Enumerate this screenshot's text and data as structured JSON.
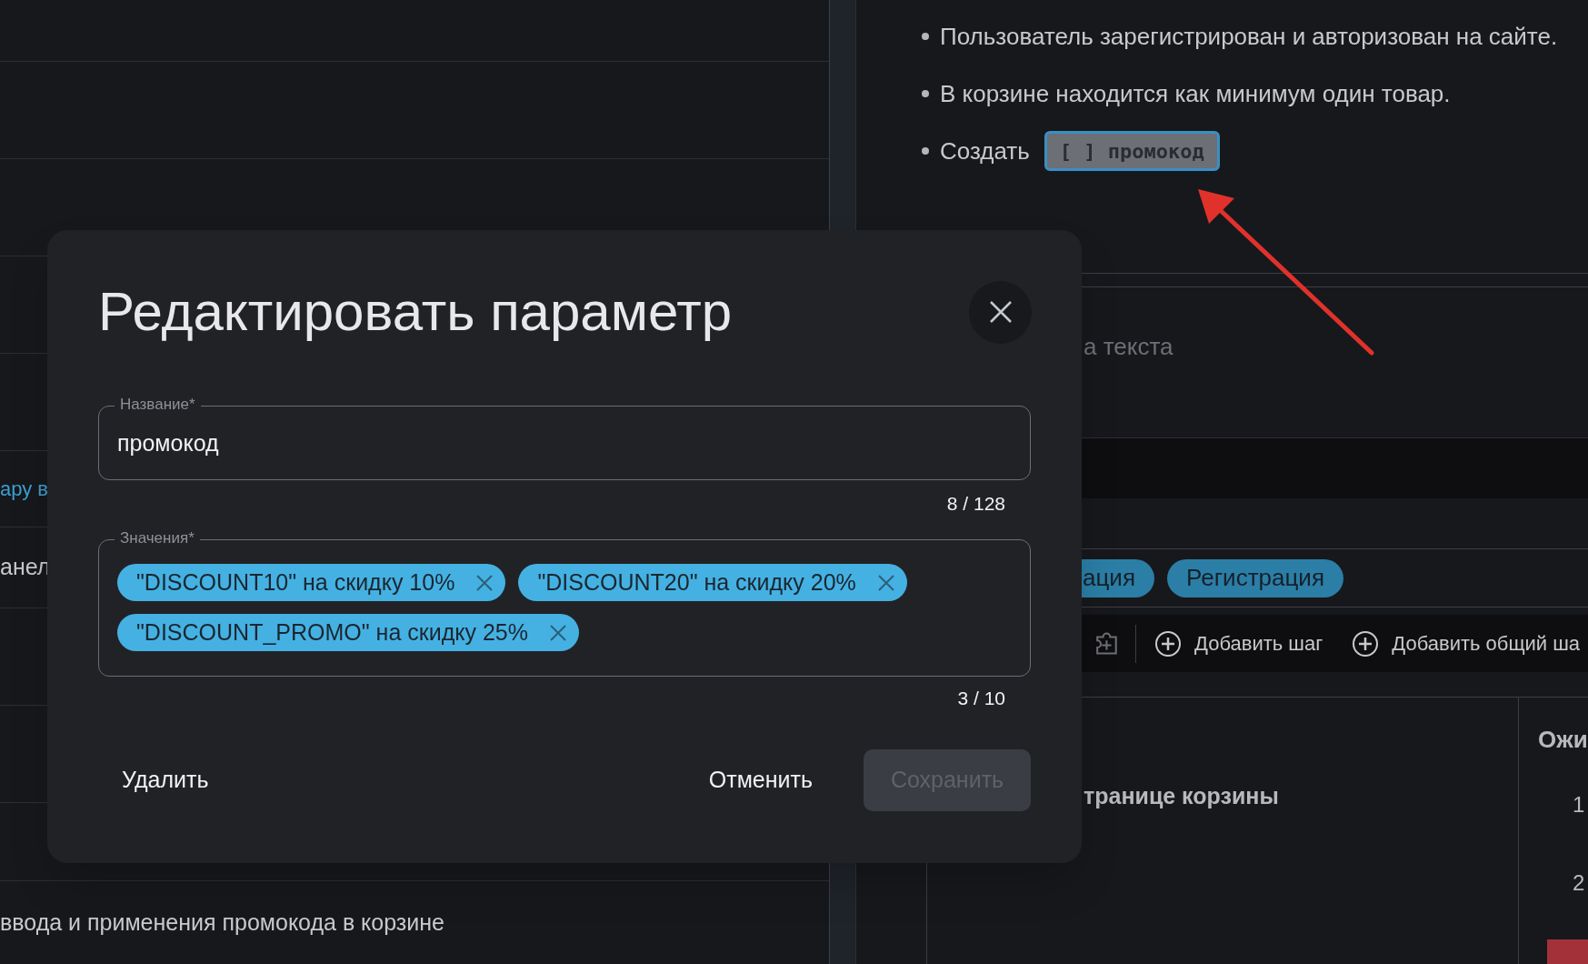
{
  "left_list": [
    {
      "text": "ару в",
      "kind": "link"
    },
    {
      "text": "анел",
      "kind": "plain"
    },
    {
      "text": "ввода и применения промокода в корзине",
      "kind": "plain"
    }
  ],
  "preconditions": [
    {
      "text": "Пользователь зарегистрирован и авторизован на сайте."
    },
    {
      "text": "В корзине находится как минимум один товар."
    },
    {
      "text": "Создать",
      "parameter": "[ ] промокод",
      "highlighted": true
    }
  ],
  "description_placeholder": "а текста",
  "tags": [
    "ация",
    "Регистрация"
  ],
  "toolbar": [
    {
      "kind": "icon"
    },
    {
      "kind": "divider"
    },
    {
      "kind": "button",
      "label": "Добавить шаг"
    },
    {
      "kind": "button",
      "label": "Добавить общий ша"
    }
  ],
  "steps_table": {
    "step_text": "транице корзины",
    "expected_header": "Ожи",
    "row_numbers": [
      "1",
      "2"
    ]
  },
  "dialog": {
    "title": "Редактировать параметр",
    "name_field": {
      "label": "Название*",
      "value": "промокод",
      "counter": "8 / 128"
    },
    "values_field": {
      "label": "Значения*",
      "counter": "3 / 10",
      "chips": [
        "\"DISCOUNT10\" на скидку 10%",
        "\"DISCOUNT20\" на скидку 20%",
        "\"DISCOUNT_PROMO\" на скидку 25%"
      ]
    },
    "delete_button": "Удалить",
    "cancel_button": "Отменить",
    "save_button": {
      "label": "Сохранить",
      "disabled": true
    }
  }
}
